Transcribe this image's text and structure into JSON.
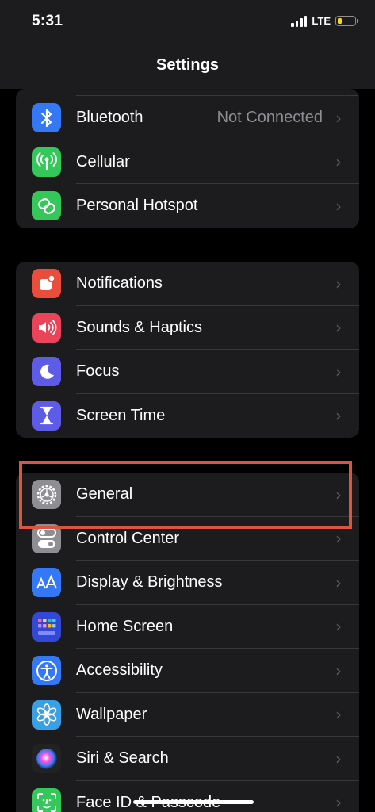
{
  "status_bar": {
    "time": "5:31",
    "network": "LTE",
    "battery_percent": 25,
    "battery_color": "#ffd60a"
  },
  "header": {
    "title": "Settings"
  },
  "groups": [
    {
      "items": [
        {
          "label": "Bluetooth",
          "value": "Not Connected",
          "icon": "bluetooth-icon",
          "color": "#3478f6"
        },
        {
          "label": "Cellular",
          "icon": "antenna-icon",
          "color": "#34c759"
        },
        {
          "label": "Personal Hotspot",
          "icon": "hotspot-link-icon",
          "color": "#34c759"
        }
      ]
    },
    {
      "items": [
        {
          "label": "Notifications",
          "icon": "bell-icon",
          "color": "#eb4d3d"
        },
        {
          "label": "Sounds & Haptics",
          "icon": "speaker-icon",
          "color": "#eb445a"
        },
        {
          "label": "Focus",
          "icon": "moon-icon",
          "color": "#5e5ce6"
        },
        {
          "label": "Screen Time",
          "icon": "hourglass-icon",
          "color": "#5e5ce6"
        }
      ]
    },
    {
      "items": [
        {
          "label": "General",
          "icon": "gear-icon",
          "color": "#8e8e93"
        },
        {
          "label": "Control Center",
          "icon": "toggles-icon",
          "color": "#8e8e93"
        },
        {
          "label": "Display & Brightness",
          "icon": "text-size-icon",
          "color": "#3478f6"
        },
        {
          "label": "Home Screen",
          "icon": "app-grid-icon",
          "color": "#3448d6"
        },
        {
          "label": "Accessibility",
          "icon": "accessibility-person-icon",
          "color": "#3478f6"
        },
        {
          "label": "Wallpaper",
          "icon": "flower-icon",
          "color": "#3aa0e6"
        },
        {
          "label": "Siri & Search",
          "icon": "siri-icon",
          "color": "#222222"
        },
        {
          "label": "Face ID & Passcode",
          "icon": "face-id-icon",
          "color": "#34c759"
        }
      ]
    }
  ],
  "chevron": "›",
  "highlight_color": "#e0533f"
}
